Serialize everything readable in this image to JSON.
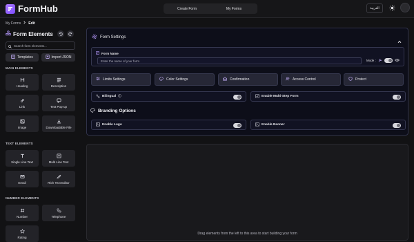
{
  "app": {
    "title": "FormHub"
  },
  "nav": {
    "create_form": "Create Form",
    "my_forms": "My Forms"
  },
  "header": {
    "language": "العربية"
  },
  "breadcrumb": {
    "parent": "My Forms",
    "current": "Edit"
  },
  "sidebar": {
    "title": "Form Elements",
    "search_placeholder": "Search form elements...",
    "templates_label": "Templates",
    "import_label": "Import JSON",
    "sections": {
      "main": "MAIN ELEMENTS",
      "text": "TEXT ELEMENTS",
      "number": "NUMBER ELEMENTS"
    },
    "main_items": [
      "Heading",
      "Description",
      "Link",
      "Text Pop-up",
      "Image",
      "Downloadable File"
    ],
    "text_items": [
      "Single Line Text",
      "Multi Line Text",
      "Email",
      "Rich Text Editor"
    ],
    "number_items": [
      "Number",
      "Telephone",
      "Rating"
    ]
  },
  "settings": {
    "title": "Form Settings",
    "form_name_label": "Form Name",
    "form_name_placeholder": "Enter the name of your form",
    "mode_label": "Mode :",
    "buttons": [
      "Limits Settings",
      "Color Settings",
      "Confirmation",
      "Access Control",
      "Protect"
    ],
    "bilingual_label": "Bilingual",
    "multistep_label": "Enable Multi-Step Form",
    "branding_title": "Branding Options",
    "logo_label": "Enable Logo",
    "banner_label": "Enable Banner"
  },
  "canvas": {
    "hint": "Drag elements from the left to this area to start building your form"
  },
  "colors": {
    "accent": "#a98bff",
    "panel_bg": "#0d0e19",
    "page_bg": "#121214"
  }
}
